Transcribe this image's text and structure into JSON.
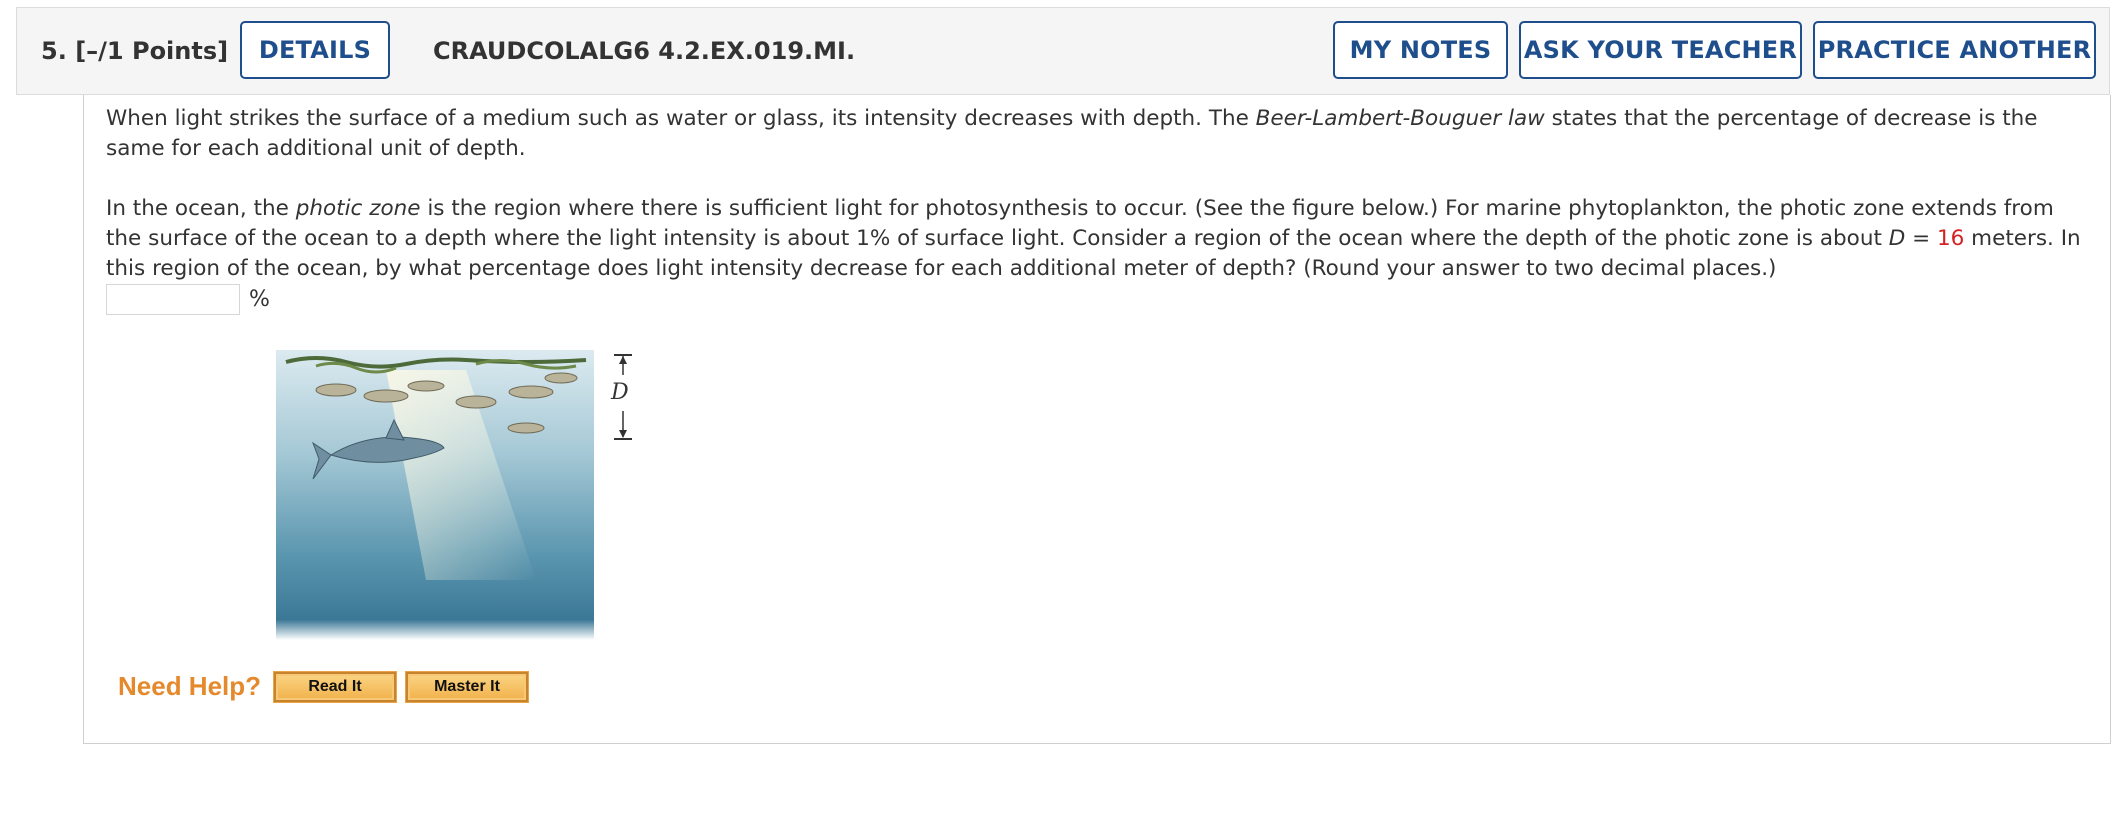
{
  "header": {
    "question_number": "5.",
    "points": "[–/1 Points]",
    "details_label": "DETAILS",
    "question_code": "CRAUDCOLALG6 4.2.EX.019.MI.",
    "my_notes_label": "MY NOTES",
    "ask_teacher_label": "ASK YOUR TEACHER",
    "practice_another_label": "PRACTICE ANOTHER"
  },
  "problem": {
    "p1_part1": "When light strikes the surface of a medium such as water or glass, its intensity decreases with depth. The ",
    "p1_italic": "Beer-Lambert-Bouguer law",
    "p1_part2": " states that the percentage of decrease is the same for each additional unit of depth.",
    "p2_part1": "In the ocean, the ",
    "p2_italic": "photic zone",
    "p2_part2": " is the region where there is sufficient light for photosynthesis to occur. (See the figure below.) For marine phytoplankton, the photic zone extends from the surface of the ocean to a depth where the light intensity is about 1% of surface light. Consider a region of the ocean where the depth of the photic zone is about ",
    "p2_var": "D",
    "p2_equals": " = ",
    "p2_value": "16",
    "p2_part3": " meters. In this region of the ocean, by what percentage does light intensity decrease for each additional meter of depth? (Round your answer to two decimal places.)"
  },
  "answer": {
    "value": "",
    "unit": "%"
  },
  "figure": {
    "depth_label": "D"
  },
  "help": {
    "label": "Need Help?",
    "read_it_label": "Read It",
    "master_it_label": "Master It"
  },
  "colors": {
    "link_blue": "#1f4e8c",
    "accent_red": "#d42121",
    "help_orange": "#e58a2c"
  }
}
